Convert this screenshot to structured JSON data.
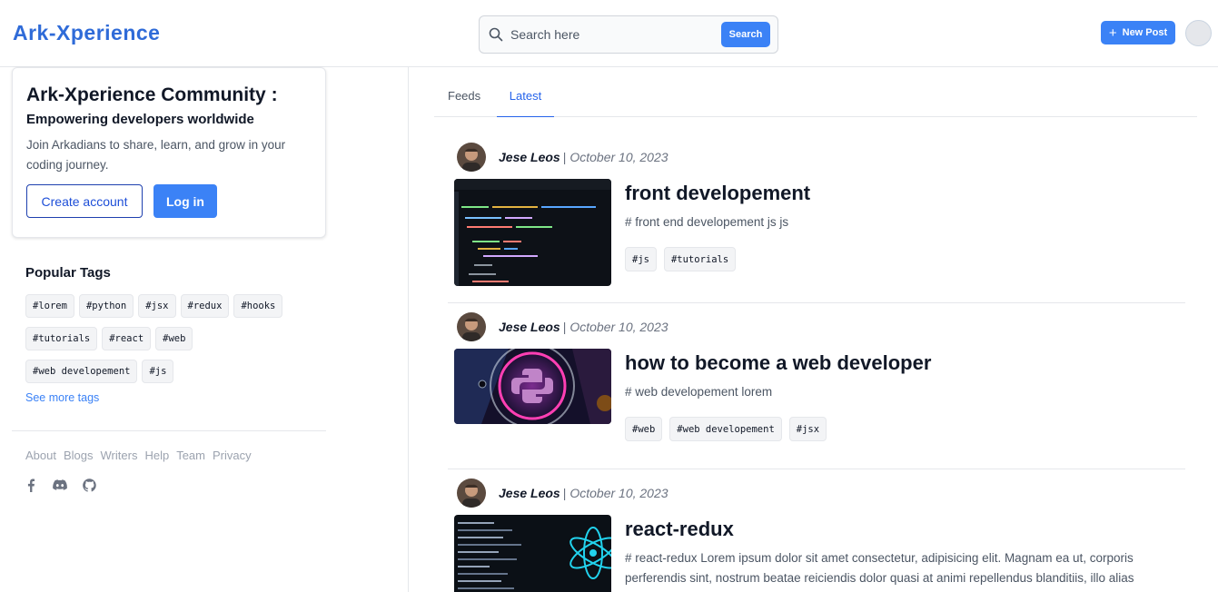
{
  "header": {
    "brand": "Ark-Xperience",
    "search": {
      "placeholder": "Search here",
      "button_label": "Search"
    },
    "new_post_label": "New Post"
  },
  "sidebar": {
    "community": {
      "title": "Ark-Xperience Community :",
      "subtitle": "Empowering developers worldwide",
      "description": "Join Arkadians to share, learn, and grow in your coding journey.",
      "create_account_label": "Create account",
      "login_label": "Log in"
    },
    "popular_tags": {
      "title": "Popular Tags",
      "tags": [
        "#lorem",
        "#python",
        "#jsx",
        "#redux",
        "#hooks",
        "#tutorials",
        "#react",
        "#web",
        "#web developement",
        "#js"
      ],
      "see_more_label": "See more tags"
    },
    "footer_links": [
      "About",
      "Blogs",
      "Writers",
      "Help",
      "Team",
      "Privacy"
    ],
    "social_icons": [
      "facebook-icon",
      "discord-icon",
      "github-icon"
    ]
  },
  "tabs": [
    {
      "label": "Feeds",
      "active": false
    },
    {
      "label": "Latest",
      "active": true
    }
  ],
  "posts": [
    {
      "author": "Jese Leos",
      "separator": "|",
      "date": "October 10, 2023",
      "title": "front developement",
      "description": "# front end developement js js",
      "tags": [
        "#js",
        "#tutorials"
      ],
      "thumbnail": "code-editor-image"
    },
    {
      "author": "Jese Leos",
      "separator": "|",
      "date": "October 10, 2023",
      "title": "how to become a web developer",
      "description": "# web developement lorem",
      "tags": [
        "#web",
        "#web developement",
        "#jsx"
      ],
      "thumbnail": "python-logo-image"
    },
    {
      "author": "Jese Leos",
      "separator": "|",
      "date": "October 10, 2023",
      "title": "react-redux",
      "description": "# react-redux Lorem ipsum dolor sit amet consectetur, adipisicing elit. Magnam ea ut, corporis perferendis sint, nostrum beatae reiciendis dolor quasi at animi repellendus blanditiis, illo alias",
      "tags": [],
      "thumbnail": "react-logo-image"
    }
  ],
  "colors": {
    "brand": "#2f6bd8",
    "primary_button": "#3b82f6",
    "active_tab": "#2563eb",
    "muted_text": "#6b7280",
    "border": "#e5e7eb"
  }
}
